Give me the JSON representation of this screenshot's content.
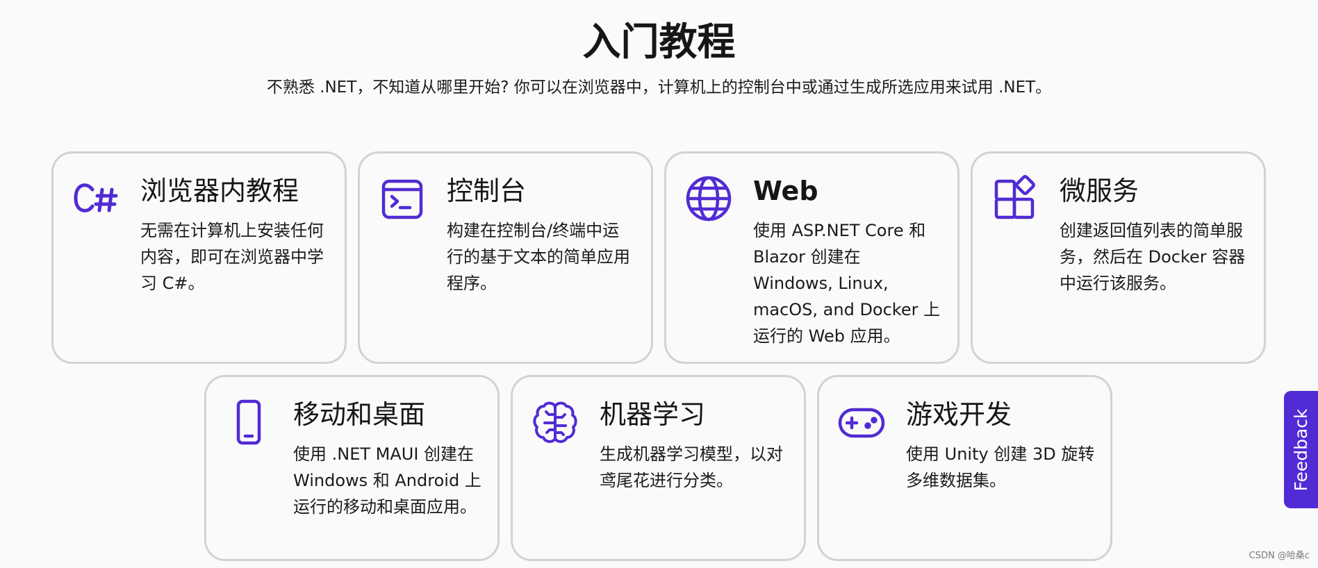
{
  "header": {
    "title": "入门教程",
    "subtitle": "不熟悉 .NET，不知道从哪里开始? 你可以在浏览器中，计算机上的控制台中或通过生成所选应用来试用 .NET。"
  },
  "cards": [
    {
      "icon": "csharp-icon",
      "title": "浏览器内教程",
      "description": "无需在计算机上安装任何内容，即可在浏览器中学习 C#。"
    },
    {
      "icon": "terminal-icon",
      "title": "控制台",
      "description": "构建在控制台/终端中运行的基于文本的简单应用程序。"
    },
    {
      "icon": "globe-icon",
      "title": "Web",
      "description": "使用 ASP.NET Core 和 Blazor 创建在 Windows, Linux, macOS, and Docker 上运行的 Web 应用。"
    },
    {
      "icon": "microservices-icon",
      "title": "微服务",
      "description": "创建返回值列表的简单服务，然后在 Docker 容器中运行该服务。"
    },
    {
      "icon": "mobile-phone-icon",
      "title": "移动和桌面",
      "description": "使用 .NET MAUI 创建在 Windows 和 Android 上运行的移动和桌面应用。"
    },
    {
      "icon": "brain-circuit-icon",
      "title": "机器学习",
      "description": "生成机器学习模型，以对鸢尾花进行分类。"
    },
    {
      "icon": "gamepad-icon",
      "title": "游戏开发",
      "description": "使用 Unity 创建 3D 旋转多维数据集。"
    }
  ],
  "feedback": {
    "label": "Feedback"
  },
  "watermark": {
    "text": "CSDN @哈桑c"
  },
  "colors": {
    "accent": "#512bd4",
    "card_border": "#d2d2d2",
    "background": "#fafafa"
  }
}
